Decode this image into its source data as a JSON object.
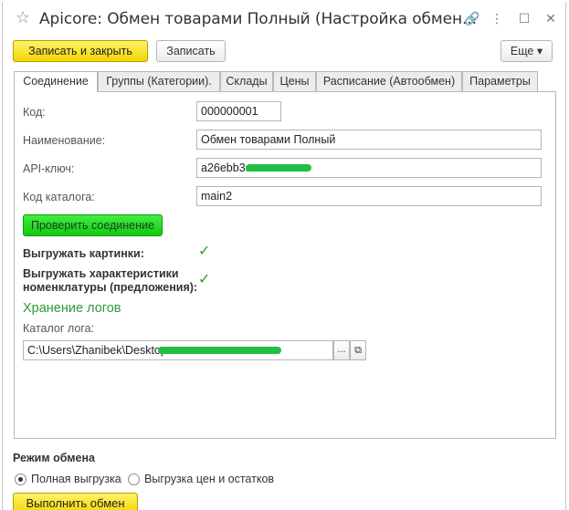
{
  "window": {
    "title": "Apicore: Обмен товарами Полный (Настройка обмен...",
    "link_icon": "🔗",
    "menu_icon": "⋮",
    "maximize_icon": "☐",
    "close_icon": "✕",
    "star_icon": "☆"
  },
  "toolbar": {
    "save_close_label": "Записать и закрыть",
    "save_label": "Записать",
    "more_label": "Еще ▾"
  },
  "tabs": [
    {
      "label": "Соединение"
    },
    {
      "label": "Группы (Категории)."
    },
    {
      "label": "Склады"
    },
    {
      "label": "Цены"
    },
    {
      "label": "Расписание (Автообмен)"
    },
    {
      "label": "Параметры"
    }
  ],
  "form": {
    "code_label": "Код:",
    "code_value": "000000001",
    "name_label": "Наименование:",
    "name_value": "Обмен товарами Полный",
    "api_label": "API-ключ:",
    "api_value": "a26ebb3c",
    "catalog_code_label": "Код каталога:",
    "catalog_code_value": "main2",
    "check_connection_label": "Проверить соединение",
    "upload_images_label": "Выгружать картинки:",
    "upload_chars_label_1": "Выгружать характеристики",
    "upload_chars_label_2": "номенклатуры (предложения):",
    "check_mark": "✓",
    "log_section_title": "Хранение логов",
    "log_dir_label": "Каталог лога:",
    "log_dir_value": "C:\\Users\\Zhanibek\\Desktop",
    "browse_label": "...",
    "open_icon": "⧉"
  },
  "exchange": {
    "mode_label": "Режим обмена",
    "full_label": "Полная выгрузка",
    "prices_label": "Выгрузка цен и остатков",
    "run_label": "Выполнить обмен"
  }
}
